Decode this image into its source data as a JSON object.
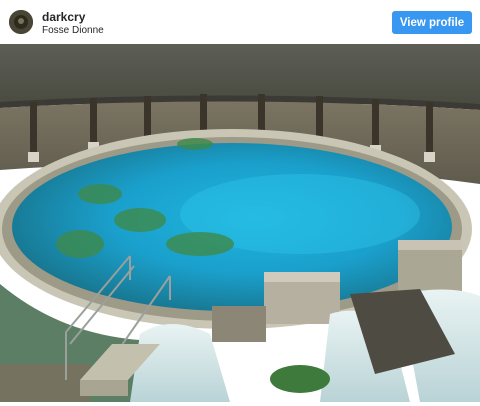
{
  "post": {
    "username": "darkcry",
    "location": "Fosse Dionne",
    "view_profile_label": "View profile"
  },
  "icons": {
    "avatar": "avatar-thumbnail"
  },
  "colors": {
    "button": "#3897f0",
    "text": "#262626"
  }
}
